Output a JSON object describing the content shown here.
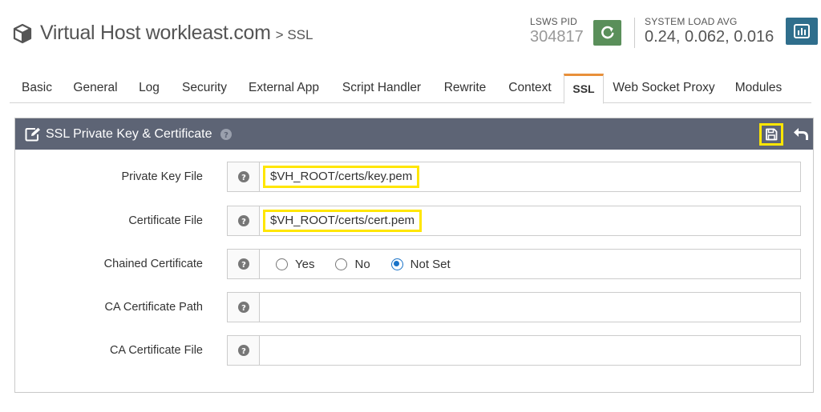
{
  "header": {
    "title": "Virtual Host workleast.com",
    "subtitle": "> SSL",
    "pid_label": "LSWS PID",
    "pid_value": "304817",
    "load_label": "SYSTEM LOAD AVG",
    "load_value": "0.24, 0.062, 0.016",
    "icons": {
      "title": "cube-icon",
      "restart": "refresh-icon",
      "stats": "bar-chart-icon"
    },
    "colors": {
      "restart_bg": "#5a8f5a",
      "stats_bg": "#2f6e8c"
    }
  },
  "tabs": [
    {
      "label": "Basic",
      "active": false
    },
    {
      "label": "General",
      "active": false
    },
    {
      "label": "Log",
      "active": false
    },
    {
      "label": "Security",
      "active": false
    },
    {
      "label": "External App",
      "active": false
    },
    {
      "label": "Script Handler",
      "active": false
    },
    {
      "label": "Rewrite",
      "active": false
    },
    {
      "label": "Context",
      "active": false
    },
    {
      "label": "SSL",
      "active": true
    },
    {
      "label": "Web Socket Proxy",
      "active": false
    },
    {
      "label": "Modules",
      "active": false
    }
  ],
  "panel": {
    "title": "SSL Private Key & Certificate",
    "icons": {
      "title": "edit-icon",
      "help": "help-icon",
      "save": "save-icon",
      "undo": "undo-icon"
    },
    "colors": {
      "header_bg": "#5d6475",
      "highlight": "#ffe600",
      "tab_accent": "#e8903a"
    },
    "rows": [
      {
        "label": "Private Key File",
        "value": "$VH_ROOT/certs/key.pem"
      },
      {
        "label": "Certificate File",
        "value": "$VH_ROOT/certs/cert.pem"
      },
      {
        "label": "Chained Certificate",
        "options": [
          "Yes",
          "No",
          "Not Set"
        ],
        "selected": "Not Set"
      },
      {
        "label": "CA Certificate Path",
        "value": ""
      },
      {
        "label": "CA Certificate File",
        "value": ""
      }
    ]
  }
}
